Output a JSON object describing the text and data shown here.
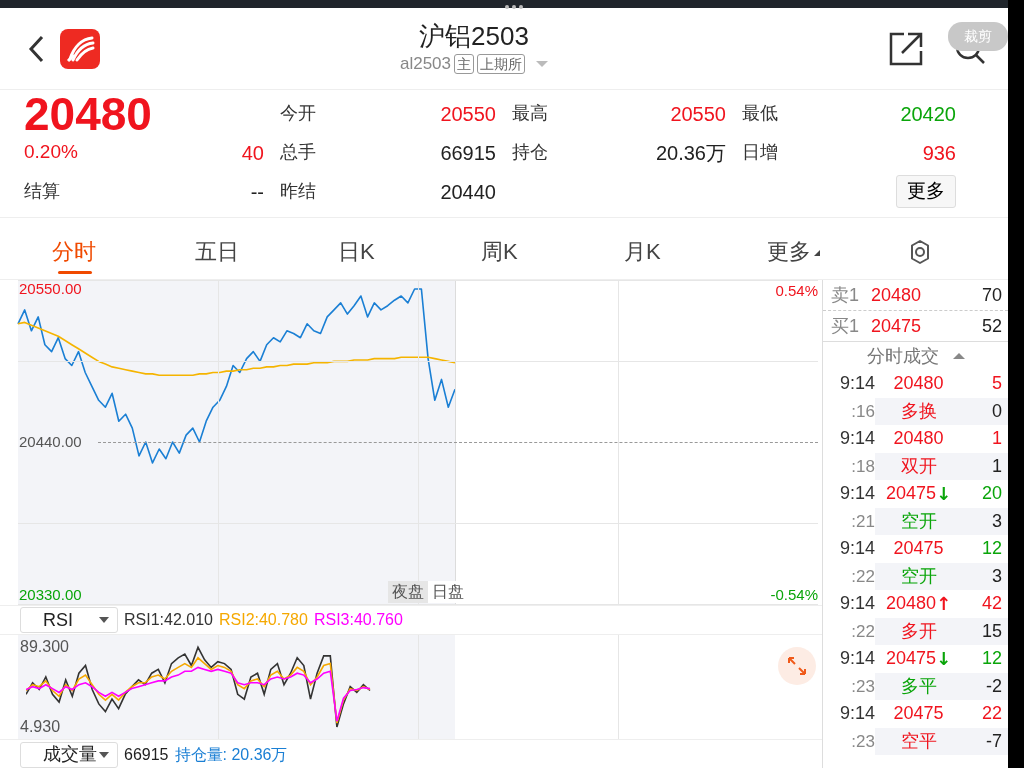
{
  "header": {
    "title": "沪铝2503",
    "code": "al2503",
    "badges": [
      "主",
      "上期所"
    ],
    "crop_label": "裁剪"
  },
  "quote": {
    "price": {
      "text": "20480",
      "color": "#f0141e"
    },
    "change_pct": {
      "text": "0.20%",
      "color": "#f0141e"
    },
    "change": {
      "text": "40",
      "color": "#f0141e"
    },
    "settle_label": "结算",
    "settle_value": "--",
    "stats": [
      {
        "label": "今开",
        "value": "20550",
        "color": "#f0141e"
      },
      {
        "label": "最高",
        "value": "20550",
        "color": "#f0141e"
      },
      {
        "label": "最低",
        "value": "20420",
        "color": "#0aa50a"
      },
      {
        "label": "总手",
        "value": "66915",
        "color": "#222222"
      },
      {
        "label": "持仓",
        "value": "20.36万",
        "color": "#222222"
      },
      {
        "label": "日增",
        "value": "936",
        "color": "#f0141e"
      },
      {
        "label": "昨结",
        "value": "20440",
        "color": "#222222"
      }
    ],
    "more_button": "更多"
  },
  "tabs": [
    {
      "label": "分时",
      "selected": true,
      "kind": "tab"
    },
    {
      "label": "五日",
      "selected": false,
      "kind": "tab"
    },
    {
      "label": "日K",
      "selected": false,
      "kind": "tab"
    },
    {
      "label": "周K",
      "selected": false,
      "kind": "tab"
    },
    {
      "label": "月K",
      "selected": false,
      "kind": "tab"
    },
    {
      "label": "更多",
      "selected": false,
      "kind": "menu"
    }
  ],
  "price_chart": {
    "pct_top": {
      "text": "0.54%",
      "color": "#f0141e"
    },
    "pct_bottom": {
      "text": "-0.54%",
      "color": "#0aa50a"
    },
    "sessions": [
      {
        "label": "夜盘",
        "selected": true
      },
      {
        "label": "日盘",
        "selected": false
      }
    ],
    "chart_data": {
      "type": "line",
      "ylim": [
        20322.8,
        20556.5
      ],
      "yticks": [
        {
          "value": 20550,
          "label": "20550.00"
        },
        {
          "value": 20440,
          "label": "20440.00"
        },
        {
          "value": 20330,
          "label": "20330.00"
        }
      ],
      "series": [
        {
          "color": "#1a7fd4",
          "values": [
            20525,
            20535,
            20520,
            20530,
            20510,
            20505,
            20515,
            20500,
            20495,
            20505,
            20490,
            20480,
            20470,
            20465,
            20475,
            20455,
            20460,
            20450,
            20430,
            20440,
            20425,
            20435,
            20428,
            20440,
            20432,
            20445,
            20450,
            20440,
            20455,
            20465,
            20470,
            20480,
            20495,
            20490,
            20500,
            20505,
            20498,
            20510,
            20515,
            20512,
            20520,
            20518,
            20515,
            20525,
            20520,
            20518,
            20530,
            20535,
            20540,
            20532,
            20538,
            20545,
            20530,
            20540,
            20535,
            20538,
            20542,
            20545,
            20540,
            20550,
            20550,
            20500,
            20470,
            20485,
            20465,
            20478,
            null,
            null,
            null,
            null,
            null,
            null,
            null,
            null,
            null,
            null,
            null,
            null,
            null,
            null,
            null,
            null,
            null,
            null,
            null,
            null,
            null,
            null,
            null,
            null,
            null,
            null,
            null,
            null,
            null,
            null,
            null,
            null,
            null,
            null,
            null,
            null,
            null,
            null,
            null,
            null,
            null,
            null,
            null,
            null,
            null,
            null,
            null,
            null,
            null,
            null,
            null,
            null,
            null,
            null
          ]
        },
        {
          "color": "#f5b400",
          "values": [
            20525,
            20526,
            20524,
            20522,
            20520,
            20518,
            20516,
            20513,
            20510,
            20507,
            20504,
            20501,
            20498,
            20496,
            20494,
            20493,
            20492,
            20491,
            20490,
            20489,
            20489,
            20488,
            20488,
            20488,
            20488,
            20488,
            20488,
            20489,
            20489,
            20490,
            20490,
            20491,
            20491,
            20492,
            20492,
            20493,
            20493,
            20494,
            20494,
            20495,
            20495,
            20496,
            20496,
            20496,
            20497,
            20497,
            20497,
            20498,
            20498,
            20498,
            20499,
            20499,
            20499,
            20500,
            20500,
            20500,
            20500,
            20501,
            20501,
            20501,
            20501,
            20501,
            20500,
            20499,
            20498,
            20497,
            null,
            null,
            null,
            null,
            null,
            null,
            null,
            null,
            null,
            null,
            null,
            null,
            null,
            null,
            null,
            null,
            null,
            null,
            null,
            null,
            null,
            null,
            null,
            null,
            null,
            null,
            null,
            null,
            null,
            null,
            null,
            null,
            null,
            null,
            null,
            null,
            null,
            null,
            null,
            null,
            null,
            null,
            null,
            null,
            null,
            null,
            null,
            null,
            null,
            null,
            null,
            null,
            null,
            null
          ]
        }
      ]
    }
  },
  "indicator": {
    "selector": "RSI",
    "readings": [
      {
        "text": "RSI1:42.010",
        "color": "#333333"
      },
      {
        "text": "RSI2:40.780",
        "color": "#f5a800"
      },
      {
        "text": "RSI3:40.760",
        "color": "#ff00ff"
      }
    ],
    "axis_labels": [
      "89.300",
      "4.930"
    ]
  },
  "volume_bar": {
    "selector": "成交量",
    "volume": "66915",
    "open_interest": "持仓量: 20.36万"
  },
  "order_book": [
    {
      "label": "卖1",
      "price": "20480",
      "volume": "70"
    },
    {
      "label": "买1",
      "price": "20475",
      "volume": "52"
    }
  ],
  "trades": {
    "title": "分时成交",
    "rows": [
      {
        "time": "9:14",
        "price": "20480",
        "volume": {
          "text": "5",
          "color": "#f0141e"
        },
        "seconds": ":16",
        "type": {
          "text": "多换",
          "color": "#f0141e"
        },
        "oi_change": "0"
      },
      {
        "time": "9:14",
        "price": "20480",
        "volume": {
          "text": "1",
          "color": "#f0141e"
        },
        "seconds": ":18",
        "type": {
          "text": "双开",
          "color": "#f0141e"
        },
        "oi_change": "1"
      },
      {
        "time": "9:14",
        "price": "20475",
        "arrow": {
          "text": "↓",
          "color": "#0aa50a"
        },
        "volume": {
          "text": "20",
          "color": "#0aa50a"
        },
        "seconds": ":21",
        "type": {
          "text": "空开",
          "color": "#0aa50a"
        },
        "oi_change": "3"
      },
      {
        "time": "9:14",
        "price": "20475",
        "volume": {
          "text": "12",
          "color": "#0aa50a"
        },
        "seconds": ":22",
        "type": {
          "text": "空开",
          "color": "#0aa50a"
        },
        "oi_change": "3"
      },
      {
        "time": "9:14",
        "price": "20480",
        "arrow": {
          "text": "↑",
          "color": "#f0141e"
        },
        "volume": {
          "text": "42",
          "color": "#f0141e"
        },
        "seconds": ":22",
        "type": {
          "text": "多开",
          "color": "#f0141e"
        },
        "oi_change": "15"
      },
      {
        "time": "9:14",
        "price": "20475",
        "arrow": {
          "text": "↓",
          "color": "#0aa50a"
        },
        "volume": {
          "text": "12",
          "color": "#0aa50a"
        },
        "seconds": ":23",
        "type": {
          "text": "多平",
          "color": "#0aa50a"
        },
        "oi_change": "-2"
      },
      {
        "time": "9:14",
        "price": "20475",
        "volume": {
          "text": "22",
          "color": "#f0141e"
        },
        "seconds": ":23",
        "type": {
          "text": "空平",
          "color": "#f0141e"
        },
        "oi_change": "-7"
      }
    ]
  }
}
